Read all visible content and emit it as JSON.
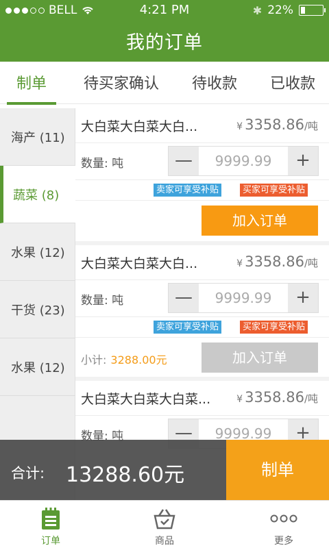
{
  "status_bar": {
    "carrier": "BELL",
    "time": "4:21 PM",
    "battery": "22%"
  },
  "header": {
    "title": "我的订单"
  },
  "tabs": [
    {
      "label": "制单",
      "active": true
    },
    {
      "label": "待买家确认"
    },
    {
      "label": "待收款"
    },
    {
      "label": "已收款"
    }
  ],
  "sidebar": {
    "items": [
      {
        "label": "海产 (11)"
      },
      {
        "label": "蔬菜 (8)",
        "active": true
      },
      {
        "label": "水果 (12)"
      },
      {
        "label": "干货 (23)"
      },
      {
        "label": "水果 (12)"
      }
    ]
  },
  "products": [
    {
      "name": "大白菜大白菜大白...",
      "currency": "¥",
      "price": "3358.86",
      "unit": "/吨",
      "qty_label": "数量: 吨",
      "qty_value": "9999.99",
      "badge_blue": "卖家可享受补贴",
      "badge_orange": "买家可享受补贴",
      "add_label": "加入订单"
    },
    {
      "name": "大白菜大白菜大白...",
      "currency": "¥",
      "price": "3358.86",
      "unit": "/吨",
      "qty_label": "数量: 吨",
      "qty_value": "9999.99",
      "badge_blue": "卖家可享受补贴",
      "badge_orange": "买家可享受补贴",
      "subtotal_label": "小计:",
      "subtotal_value": "3288.00元",
      "add_label": "加入订单"
    },
    {
      "name": "大白菜大白菜大白菜...",
      "currency": "¥",
      "price": "3358.86",
      "unit": "/吨",
      "qty_label": "数量: 吨",
      "qty_value": "9999.99"
    }
  ],
  "stepper": {
    "minus": "—",
    "plus": "+"
  },
  "total": {
    "label": "合计:",
    "value": "13288.60元"
  },
  "make_button": "制单",
  "bottom_nav": [
    {
      "label": "订单",
      "icon": "order-list-icon",
      "active": true
    },
    {
      "label": "商品",
      "icon": "basket-icon"
    },
    {
      "label": "更多",
      "icon": "more-dots-icon"
    }
  ],
  "colors": {
    "primary": "#5a9a33",
    "orange": "#f89a12",
    "badge_blue": "#3ea3dc",
    "badge_orange": "#ec5d2f"
  }
}
